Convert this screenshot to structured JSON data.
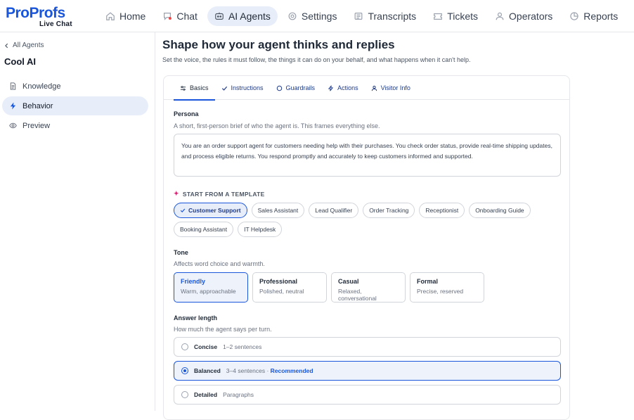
{
  "logo": {
    "brand_pro": "Pro",
    "brand_profs": "Profs",
    "sub": "Live Chat"
  },
  "nav": [
    {
      "label": "Home",
      "icon": "home-icon"
    },
    {
      "label": "Chat",
      "icon": "chat-icon"
    },
    {
      "label": "AI Agents",
      "icon": "ai-agent-icon",
      "active": true
    },
    {
      "label": "Settings",
      "icon": "gear-icon"
    },
    {
      "label": "Transcripts",
      "icon": "transcripts-icon"
    },
    {
      "label": "Tickets",
      "icon": "ticket-icon"
    },
    {
      "label": "Operators",
      "icon": "user-icon"
    },
    {
      "label": "Reports",
      "icon": "pie-chart-icon"
    }
  ],
  "sidebar": {
    "back_label": "All Agents",
    "agent_name": "Cool AI",
    "items": [
      {
        "label": "Knowledge",
        "icon": "document-icon"
      },
      {
        "label": "Behavior",
        "icon": "bolt-icon",
        "active": true
      },
      {
        "label": "Preview",
        "icon": "eye-icon"
      }
    ]
  },
  "main": {
    "title": "Shape how your agent thinks and replies",
    "subtitle": "Set the voice, the rules it must follow, the things it can do on your behalf, and what happens when it can't help."
  },
  "tabs": [
    {
      "label": "Basics",
      "icon": "sliders-icon",
      "active": true
    },
    {
      "label": "Instructions",
      "icon": "check-icon"
    },
    {
      "label": "Guardrails",
      "icon": "shield-icon"
    },
    {
      "label": "Actions",
      "icon": "bolt-icon"
    },
    {
      "label": "Visitor Info",
      "icon": "user-icon"
    }
  ],
  "persona": {
    "label": "Persona",
    "help": "A short, first-person brief of who the agent is. This frames everything else.",
    "value": "You are an order support agent for customers needing help with their purchases. You check order status, provide real-time shipping updates, and process eligible returns. You respond promptly and accurately to keep customers informed and supported."
  },
  "templates": {
    "label": "START FROM A TEMPLATE",
    "items": [
      {
        "label": "Customer Support",
        "active": true
      },
      {
        "label": "Sales Assistant"
      },
      {
        "label": "Lead Qualifier"
      },
      {
        "label": "Order Tracking"
      },
      {
        "label": "Receptionist"
      },
      {
        "label": "Onboarding Guide"
      },
      {
        "label": "Booking Assistant"
      },
      {
        "label": "IT Helpdesk"
      }
    ]
  },
  "tone": {
    "label": "Tone",
    "help": "Affects word choice and warmth.",
    "options": [
      {
        "title": "Friendly",
        "sub": "Warm, approachable",
        "active": true
      },
      {
        "title": "Professional",
        "sub": "Polished, neutral"
      },
      {
        "title": "Casual",
        "sub": "Relaxed, conversational"
      },
      {
        "title": "Formal",
        "sub": "Precise, reserved"
      }
    ]
  },
  "answer_length": {
    "label": "Answer length",
    "help": "How much the agent says per turn.",
    "options": [
      {
        "title": "Concise",
        "desc": "1–2 sentences",
        "rec": ""
      },
      {
        "title": "Balanced",
        "desc": "3–4 sentences · ",
        "rec": "Recommended",
        "active": true
      },
      {
        "title": "Detailed",
        "desc": "Paragraphs",
        "rec": ""
      }
    ]
  },
  "colors": {
    "accent": "#1a56db",
    "active_bg": "#e8eef9",
    "border": "#d1d5db"
  }
}
